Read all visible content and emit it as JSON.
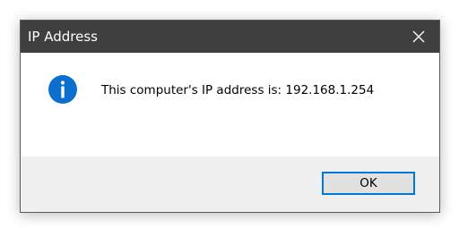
{
  "window": {
    "title": "IP Address"
  },
  "titlebar": {
    "close_icon": "close-icon"
  },
  "content": {
    "icon": "info-icon",
    "message": "This computer's IP address is: 192.168.1.254"
  },
  "buttons": {
    "ok_label": "OK"
  },
  "colors": {
    "titlebar_bg": "#3f3f3f",
    "info_icon": "#0c6fcf",
    "footer_bg": "#f0f0f0",
    "button_focus_border": "#0078d7"
  }
}
